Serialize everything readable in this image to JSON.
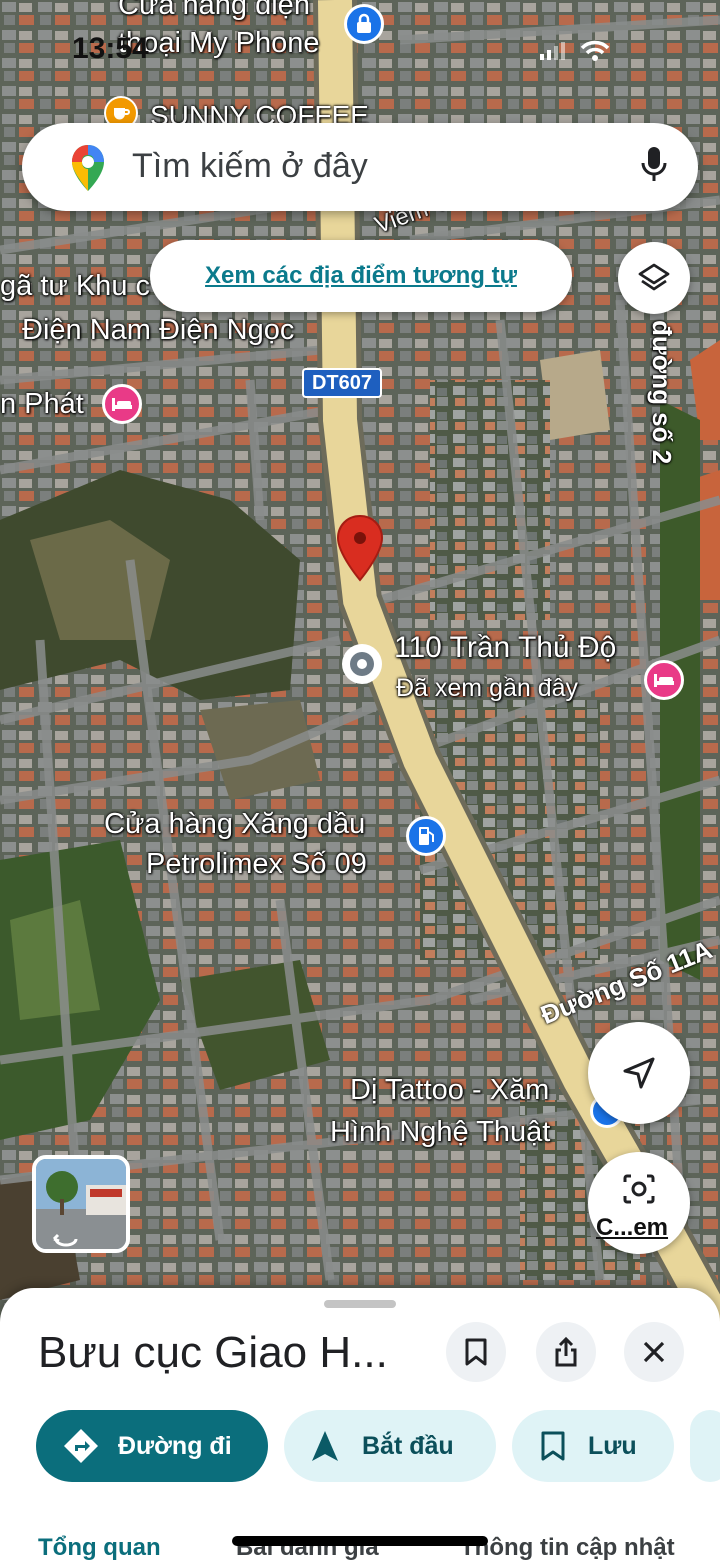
{
  "status_bar": {
    "time": "13:54"
  },
  "search": {
    "placeholder": "Tìm kiếm ở đây"
  },
  "similar_chip": {
    "label": "Xem các địa điểm tương tự"
  },
  "map": {
    "labels": {
      "phone_store": "Cửa hàng điện thoại My Phone",
      "coffee": "SUNNY COFFEE",
      "nga_tu": "gã tư Khu c",
      "dien_nam": "Điện Nam Điện Ngọc",
      "phat": "n Phát",
      "road_dt607": "DT607",
      "duong_so_2": "đường số 2",
      "viem_truong": "Viêm Trườ",
      "address": "110 Trần Thủ Độ",
      "viewed": "Đã xem gần đây",
      "gas_line1": "Cửa hàng Xăng dầu",
      "gas_line2": "Petrolimex Số 09",
      "duong_11a": "Đường Số 11A",
      "tattoo_line1": "Dị Tattoo - Xăm",
      "tattoo_line2": "Hình Nghệ Thuật"
    }
  },
  "lens": {
    "label": "C...em"
  },
  "sheet": {
    "title": "Bưu cục Giao H...",
    "actions": {
      "directions": "Đường đi",
      "start": "Bắt đầu",
      "save": "Lưu"
    },
    "tabs": {
      "overview": "Tổng quan",
      "reviews": "Bài đánh giá",
      "updates": "Thông tin cập nhật"
    }
  },
  "colors": {
    "teal": "#0b6e7c",
    "chip_text": "#0b7a8c",
    "pale_teal": "#dff3f6",
    "road": "#e8d69a",
    "pin_red": "#d92d20"
  }
}
